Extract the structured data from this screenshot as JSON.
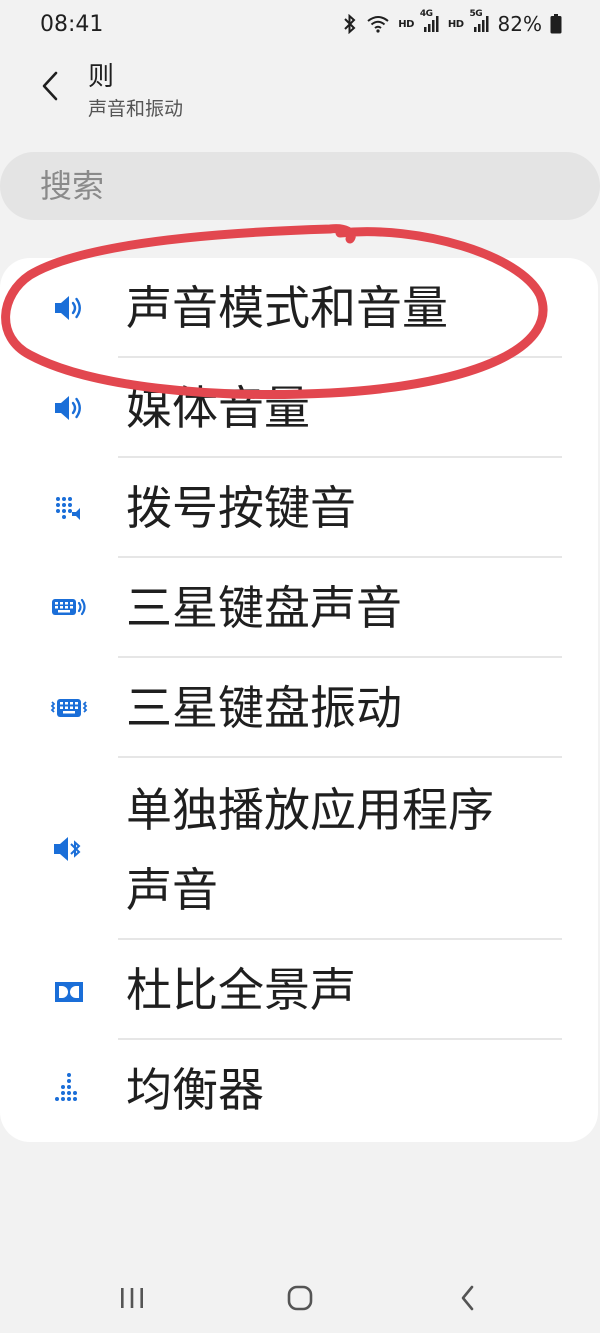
{
  "status_bar": {
    "time": "08:41",
    "hd1": "HD",
    "net1": "4G",
    "hd2": "HD",
    "net2": "5G",
    "battery": "82%"
  },
  "header": {
    "title": "则",
    "subtitle": "声音和振动"
  },
  "search": {
    "placeholder": "搜索"
  },
  "items": [
    {
      "label": "声音模式和音量",
      "icon": "volume-icon"
    },
    {
      "label": "媒体音量",
      "icon": "volume-icon"
    },
    {
      "label": "拨号按键音",
      "icon": "dialpad-sound-icon"
    },
    {
      "label": "三星键盘声音",
      "icon": "keyboard-sound-icon"
    },
    {
      "label": "三星键盘振动",
      "icon": "keyboard-vibration-icon"
    },
    {
      "label_line1": "单独播放应用程序",
      "label_line2": "声音",
      "icon": "bluetooth-audio-icon"
    },
    {
      "label": "杜比全景声",
      "icon": "dolby-icon"
    },
    {
      "label": "均衡器",
      "icon": "equalizer-icon"
    }
  ],
  "colors": {
    "accent": "#1a6ed8",
    "annotation": "#e2474f",
    "background": "#f2f2f2",
    "card": "#ffffff"
  }
}
